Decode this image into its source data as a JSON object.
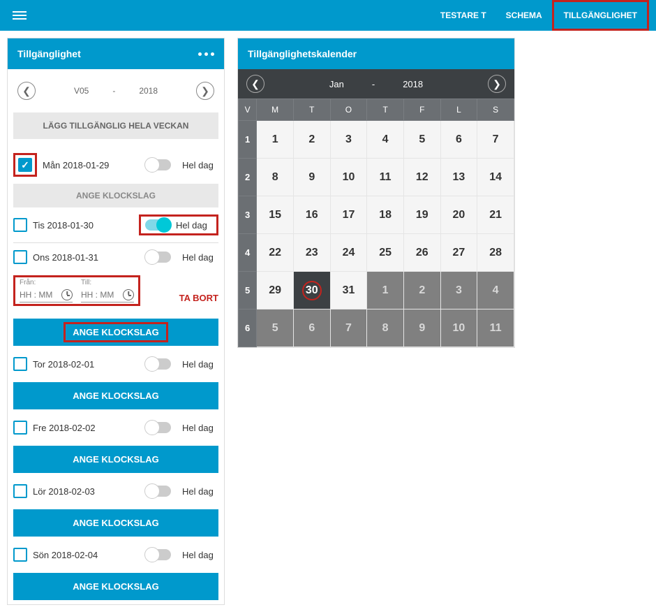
{
  "nav": {
    "user": "TESTARE T",
    "schema": "SCHEMA",
    "availability": "TILLGÄNGLIGHET"
  },
  "avail": {
    "title": "Tillgänglighet",
    "week": "V05",
    "year": "2018",
    "btn_week": "LÄGG TILLGÄNGLIG HELA VECKAN",
    "hel_dag": "Hel dag",
    "ange": "ANGE KLOCKSLAG",
    "fr": "Från:",
    "till": "Till:",
    "placeholder": "HH : MM",
    "ta_bort": "TA BORT",
    "days": [
      {
        "label": "Mån 2018-01-29",
        "checked": true
      },
      {
        "label": "Tis 2018-01-30",
        "checked": false,
        "toggle_on": true
      },
      {
        "label": "Ons 2018-01-31",
        "checked": false
      },
      {
        "label": "Tor 2018-02-01",
        "checked": false
      },
      {
        "label": "Fre 2018-02-02",
        "checked": false
      },
      {
        "label": "Lör 2018-02-03",
        "checked": false
      },
      {
        "label": "Sön 2018-02-04",
        "checked": false
      }
    ]
  },
  "cal": {
    "title": "Tillgänglighetskalender",
    "month": "Jan",
    "year": "2018",
    "weekdays": [
      "V",
      "M",
      "T",
      "O",
      "T",
      "F",
      "L",
      "S"
    ],
    "rows": [
      {
        "w": "1",
        "d": [
          {
            "n": "1"
          },
          {
            "n": "2"
          },
          {
            "n": "3"
          },
          {
            "n": "4"
          },
          {
            "n": "5"
          },
          {
            "n": "6"
          },
          {
            "n": "7"
          }
        ]
      },
      {
        "w": "2",
        "d": [
          {
            "n": "8"
          },
          {
            "n": "9"
          },
          {
            "n": "10"
          },
          {
            "n": "11"
          },
          {
            "n": "12"
          },
          {
            "n": "13"
          },
          {
            "n": "14"
          }
        ]
      },
      {
        "w": "3",
        "d": [
          {
            "n": "15"
          },
          {
            "n": "16"
          },
          {
            "n": "17"
          },
          {
            "n": "18"
          },
          {
            "n": "19"
          },
          {
            "n": "20"
          },
          {
            "n": "21"
          }
        ]
      },
      {
        "w": "4",
        "d": [
          {
            "n": "22"
          },
          {
            "n": "23"
          },
          {
            "n": "24"
          },
          {
            "n": "25"
          },
          {
            "n": "26"
          },
          {
            "n": "27"
          },
          {
            "n": "28"
          }
        ]
      },
      {
        "w": "5",
        "d": [
          {
            "n": "29"
          },
          {
            "n": "30",
            "sel": true
          },
          {
            "n": "31"
          },
          {
            "n": "1",
            "o": true
          },
          {
            "n": "2",
            "o": true
          },
          {
            "n": "3",
            "o": true
          },
          {
            "n": "4",
            "o": true
          }
        ]
      },
      {
        "w": "6",
        "d": [
          {
            "n": "5",
            "o": true
          },
          {
            "n": "6",
            "o": true
          },
          {
            "n": "7",
            "o": true
          },
          {
            "n": "8",
            "o": true
          },
          {
            "n": "9",
            "o": true
          },
          {
            "n": "10",
            "o": true
          },
          {
            "n": "11",
            "o": true
          }
        ]
      }
    ]
  }
}
